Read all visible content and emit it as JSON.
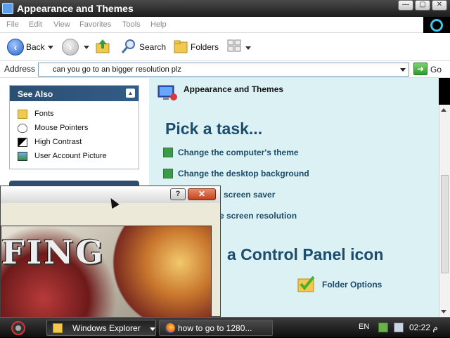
{
  "window": {
    "title": "Appearance and Themes",
    "controls": {
      "minimize": "—",
      "maximize": "▢",
      "close": "✕"
    }
  },
  "menubar": {
    "items": [
      "File",
      "Edit",
      "View",
      "Favorites",
      "Tools",
      "Help"
    ]
  },
  "toolbar": {
    "back_label": "Back",
    "search_label": "Search",
    "folders_label": "Folders"
  },
  "address": {
    "label": "Address",
    "value": "can you go to an bigger resolution plz",
    "go_label": "Go"
  },
  "see_also": {
    "title": "See Also",
    "items": [
      {
        "label": "Fonts",
        "icon": "folder-icon"
      },
      {
        "label": "Mouse Pointers",
        "icon": "mouse-icon"
      },
      {
        "label": "High Contrast",
        "icon": "contrast-icon"
      },
      {
        "label": "User Account Picture",
        "icon": "picture-icon"
      }
    ]
  },
  "main": {
    "category_title": "Appearance and Themes",
    "pick_task_heading": "Pick a task...",
    "tasks": [
      "Change the computer's theme",
      "Change the desktop background",
      "screen saver",
      "e screen resolution"
    ],
    "control_panel_heading": "a Control Panel icon",
    "icons": [
      {
        "label": "Folder Options",
        "icon": "folder-options-icon"
      }
    ]
  },
  "dialog": {
    "help_label": "?",
    "close_label": "✕",
    "wallpaper_text": "FING"
  },
  "taskbar": {
    "buttons": [
      {
        "label": "Windows Explorer",
        "icon": "folder-icon",
        "active": true
      },
      {
        "label": "how to go to 1280...",
        "icon": "firefox-icon",
        "active": false
      }
    ],
    "tray": {
      "language": "EN",
      "clock": "02:22 م"
    }
  }
}
